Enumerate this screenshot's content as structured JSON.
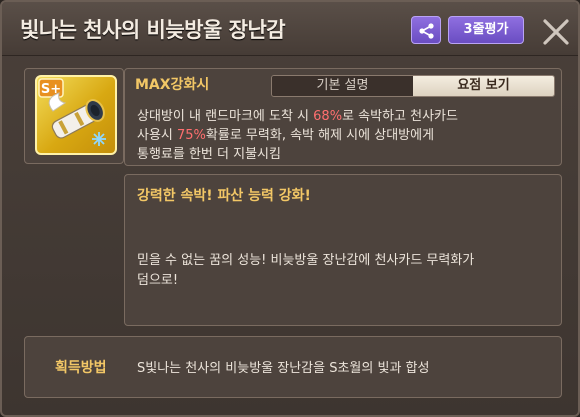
{
  "window": {
    "title": "빛나는 천사의 비늦방울 장난감",
    "rate_label": "3줄평가"
  },
  "item": {
    "icon": "angel-toy-cannon-icon",
    "grade_badge": "S+",
    "max_label": "MAX강화시",
    "tabs": [
      "기본 설명",
      "요점 보기"
    ],
    "desc_line1_a": "상대방이 내 랜드마크에 도착 시 ",
    "desc_pct1": "68%",
    "desc_line1_b": "로 속박하고 천사카드",
    "desc_line2_a": "사용시 ",
    "desc_pct2": "75%",
    "desc_line2_b": "확률로 무력화, 속박 해제 시에 상대방에게",
    "desc_line3": "통행료를 한번 더 지불시킴"
  },
  "quote": {
    "title": "강력한 속박! 파산 능력 강화!",
    "line1": "믿을 수 없는 꿈의 성능! 비늦방울 장난감에 천사카드 무력화가",
    "line2": "덤으로!"
  },
  "acquire": {
    "label": "획득방법",
    "text": "S빛나는 천사의 비늦방울 장난감을 S초월의 빛과 합성"
  },
  "colors": {
    "accent_gold": "#f2c766",
    "highlight_red": "#ff6f6f",
    "button_purple": "#7a5bd2"
  }
}
